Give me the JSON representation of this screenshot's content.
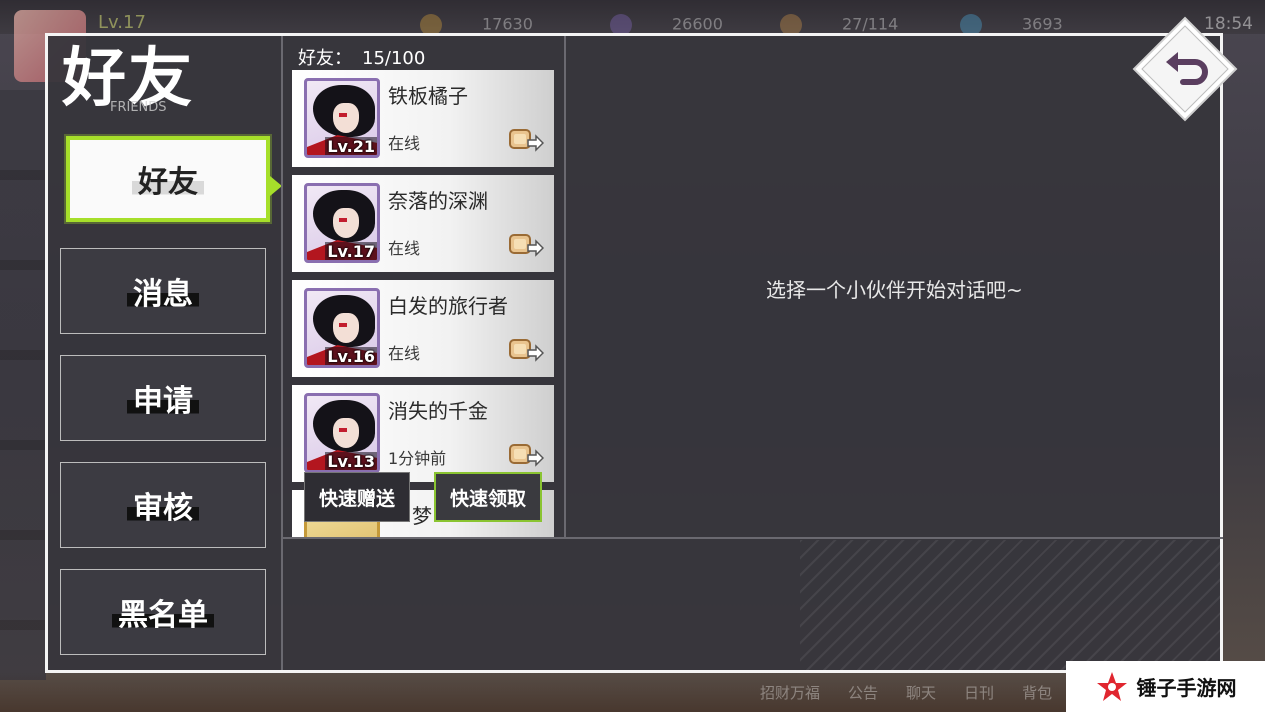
{
  "background": {
    "player_level": "Lv.17",
    "resources": [
      {
        "icon": "gold-coin-icon",
        "value": "17630",
        "color": "#e1a83a"
      },
      {
        "icon": "purple-crystal-icon",
        "value": "26600",
        "color": "#8a6cc8"
      },
      {
        "icon": "bread-stamina-icon",
        "value": "27/114",
        "color": "#d89a4a"
      },
      {
        "icon": "blue-gem-icon",
        "value": "3693",
        "color": "#4db3e6"
      }
    ],
    "time": "18:54",
    "bottom_tabs": [
      "招财万福",
      "公告",
      "聊天",
      "日刊",
      "背包"
    ]
  },
  "panel": {
    "title": "好友",
    "subtitle": "FRIENDS",
    "nav": [
      {
        "label": "好友",
        "active": true
      },
      {
        "label": "消息",
        "active": false
      },
      {
        "label": "申请",
        "active": false
      },
      {
        "label": "审核",
        "active": false
      },
      {
        "label": "黑名单",
        "active": false
      }
    ],
    "friend_count_label": "好友：",
    "friend_count": "15/100",
    "friends": [
      {
        "name": "铁板橘子",
        "level": "Lv.21",
        "status": "在线"
      },
      {
        "name": "奈落的深渊",
        "level": "Lv.17",
        "status": "在线"
      },
      {
        "name": "白发的旅行者",
        "level": "Lv.16",
        "status": "在线"
      },
      {
        "name": "消失的千金",
        "level": "Lv.13",
        "status": "1分钟前"
      },
      {
        "name": "梦",
        "level": "",
        "status": ""
      }
    ],
    "quick_send": "快速赠送",
    "quick_claim": "快速领取",
    "hint": "选择一个小伙伴开始对话吧~",
    "accent_color": "#a6df2a"
  },
  "watermark": {
    "text": "锤子手游网"
  }
}
